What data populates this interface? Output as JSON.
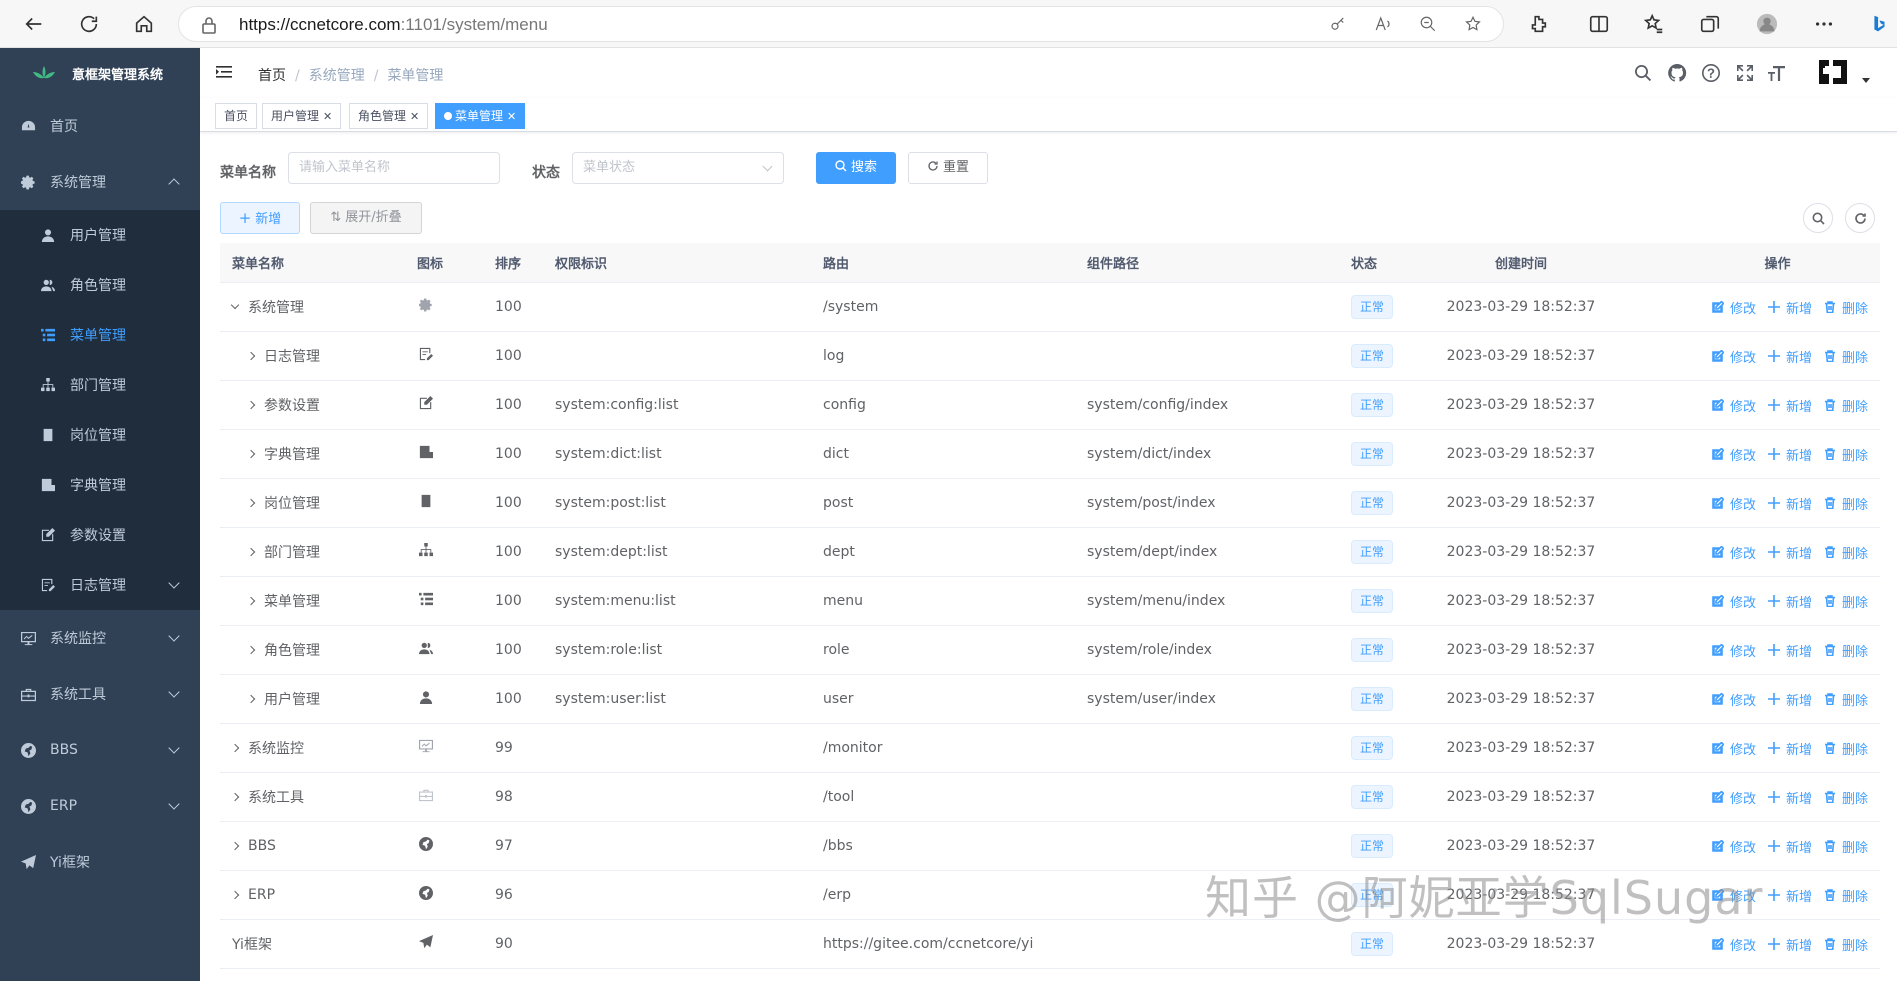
{
  "browser": {
    "url_host": "https://ccnetcore.com",
    "url_rest": ":1101/system/menu"
  },
  "sidebar": {
    "logo_text": "意框架管理系统",
    "items": [
      {
        "label": "首页",
        "icon": "dashboard-icon"
      },
      {
        "label": "系统管理",
        "icon": "gear-icon",
        "expanded": true,
        "children": [
          {
            "label": "用户管理",
            "icon": "user-icon"
          },
          {
            "label": "角色管理",
            "icon": "peoples-icon"
          },
          {
            "label": "菜单管理",
            "icon": "tree-table-icon",
            "active": true
          },
          {
            "label": "部门管理",
            "icon": "tree-icon"
          },
          {
            "label": "岗位管理",
            "icon": "post-icon"
          },
          {
            "label": "字典管理",
            "icon": "dict-icon"
          },
          {
            "label": "参数设置",
            "icon": "edit-icon"
          },
          {
            "label": "日志管理",
            "icon": "log-icon"
          }
        ]
      },
      {
        "label": "系统监控",
        "icon": "monitor-icon"
      },
      {
        "label": "系统工具",
        "icon": "tool-icon"
      },
      {
        "label": "BBS",
        "icon": "globe-icon"
      },
      {
        "label": "ERP",
        "icon": "globe-icon"
      },
      {
        "label": "Yi框架",
        "icon": "send-icon"
      }
    ]
  },
  "breadcrumb": [
    "首页",
    "系统管理",
    "菜单管理"
  ],
  "tags": [
    {
      "label": "首页",
      "closable": false
    },
    {
      "label": "用户管理",
      "closable": true
    },
    {
      "label": "角色管理",
      "closable": true
    },
    {
      "label": "菜单管理",
      "closable": true,
      "active": true
    }
  ],
  "search": {
    "name_label": "菜单名称",
    "name_placeholder": "请输入菜单名称",
    "status_label": "状态",
    "status_placeholder": "菜单状态",
    "search_button": "搜索",
    "reset_button": "重置"
  },
  "toolbar": {
    "add_button": "新增",
    "expand_button": "展开/折叠"
  },
  "table": {
    "headers": [
      "菜单名称",
      "图标",
      "排序",
      "权限标识",
      "路由",
      "组件路径",
      "状态",
      "创建时间",
      "操作"
    ],
    "ops": {
      "edit": "修改",
      "add": "新增",
      "delete": "删除"
    },
    "rows": [
      {
        "name": "系统管理",
        "level": 0,
        "exp": "open",
        "icon": "gear-icon",
        "sort": "100",
        "perm": "",
        "route": "/system",
        "comp": "",
        "status": "正常",
        "time": "2023-03-29 18:52:37"
      },
      {
        "name": "日志管理",
        "level": 1,
        "exp": "closed",
        "icon": "log-icon",
        "sort": "100",
        "perm": "",
        "route": "log",
        "comp": "",
        "status": "正常",
        "time": "2023-03-29 18:52:37"
      },
      {
        "name": "参数设置",
        "level": 1,
        "exp": "closed",
        "icon": "edit-icon",
        "sort": "100",
        "perm": "system:config:list",
        "route": "config",
        "comp": "system/config/index",
        "status": "正常",
        "time": "2023-03-29 18:52:37"
      },
      {
        "name": "字典管理",
        "level": 1,
        "exp": "closed",
        "icon": "dict-icon",
        "sort": "100",
        "perm": "system:dict:list",
        "route": "dict",
        "comp": "system/dict/index",
        "status": "正常",
        "time": "2023-03-29 18:52:37"
      },
      {
        "name": "岗位管理",
        "level": 1,
        "exp": "closed",
        "icon": "post-icon",
        "sort": "100",
        "perm": "system:post:list",
        "route": "post",
        "comp": "system/post/index",
        "status": "正常",
        "time": "2023-03-29 18:52:37"
      },
      {
        "name": "部门管理",
        "level": 1,
        "exp": "closed",
        "icon": "tree-icon",
        "sort": "100",
        "perm": "system:dept:list",
        "route": "dept",
        "comp": "system/dept/index",
        "status": "正常",
        "time": "2023-03-29 18:52:37"
      },
      {
        "name": "菜单管理",
        "level": 1,
        "exp": "closed",
        "icon": "tree-table-icon",
        "sort": "100",
        "perm": "system:menu:list",
        "route": "menu",
        "comp": "system/menu/index",
        "status": "正常",
        "time": "2023-03-29 18:52:37"
      },
      {
        "name": "角色管理",
        "level": 1,
        "exp": "closed",
        "icon": "peoples-icon",
        "sort": "100",
        "perm": "system:role:list",
        "route": "role",
        "comp": "system/role/index",
        "status": "正常",
        "time": "2023-03-29 18:52:37"
      },
      {
        "name": "用户管理",
        "level": 1,
        "exp": "closed",
        "icon": "user-icon",
        "sort": "100",
        "perm": "system:user:list",
        "route": "user",
        "comp": "system/user/index",
        "status": "正常",
        "time": "2023-03-29 18:52:37"
      },
      {
        "name": "系统监控",
        "level": 0,
        "exp": "closed",
        "icon": "monitor-icon",
        "sort": "99",
        "perm": "",
        "route": "/monitor",
        "comp": "",
        "status": "正常",
        "time": "2023-03-29 18:52:37"
      },
      {
        "name": "系统工具",
        "level": 0,
        "exp": "closed",
        "icon": "tool-icon",
        "sort": "98",
        "perm": "",
        "route": "/tool",
        "comp": "",
        "status": "正常",
        "time": "2023-03-29 18:52:37"
      },
      {
        "name": "BBS",
        "level": 0,
        "exp": "closed",
        "icon": "globe-icon",
        "sort": "97",
        "perm": "",
        "route": "/bbs",
        "comp": "",
        "status": "正常",
        "time": "2023-03-29 18:52:37"
      },
      {
        "name": "ERP",
        "level": 0,
        "exp": "closed",
        "icon": "globe-icon",
        "sort": "96",
        "perm": "",
        "route": "/erp",
        "comp": "",
        "status": "正常",
        "time": "2023-03-29 18:52:37"
      },
      {
        "name": "Yi框架",
        "level": 0,
        "exp": "none",
        "icon": "send-icon",
        "sort": "90",
        "perm": "",
        "route": "https://gitee.com/ccnetcore/yi",
        "comp": "",
        "status": "正常",
        "time": "2023-03-29 18:52:37"
      }
    ]
  },
  "watermark": "知乎 @阿妮亚学SqlSugar",
  "colors": {
    "sidebar_bg": "#304156",
    "submenu_bg": "#1f2d3d",
    "primary": "#409eff",
    "sidebar_text": "#bfcbd9"
  }
}
